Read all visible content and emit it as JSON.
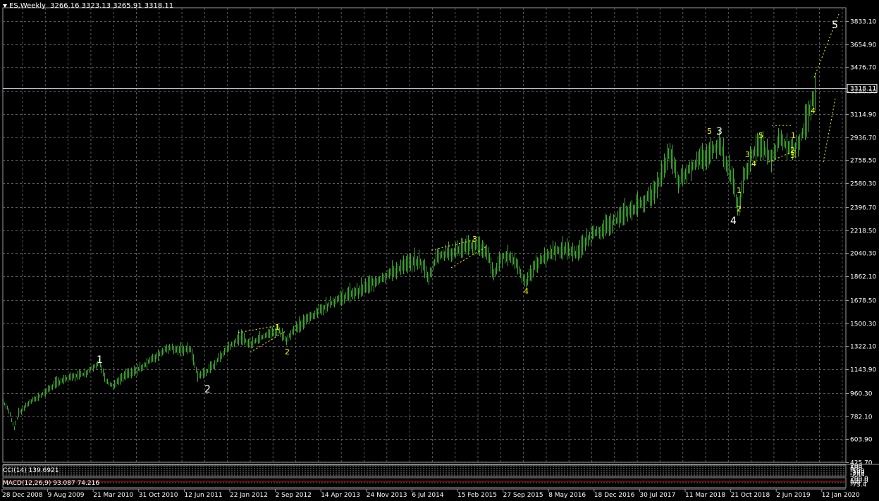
{
  "chart_header": {
    "symbol": "ES,Weekly",
    "ohlc": "3266.16 3323.13 3265.91 3318.11"
  },
  "price_axis": {
    "labels": [
      "3833.10",
      "3654.90",
      "3476.70",
      "3318.11",
      "3296.50",
      "3114.90",
      "2936.70",
      "2758.50",
      "2580.30",
      "2396.70",
      "2218.50",
      "2040.30",
      "1862.10",
      "1678.50",
      "1500.30",
      "1322.10",
      "1143.90",
      "960.30",
      "782.10",
      "603.90",
      "425.70"
    ],
    "current_price": "3318.11",
    "current_price_color": "#ffffff",
    "bid_line_color": "#b8c4d0"
  },
  "time_axis": {
    "labels": [
      "28 Dec 2008",
      "9 Aug 2009",
      "21 Mar 2010",
      "31 Oct 2010",
      "12 Jun 2011",
      "22 Jan 2012",
      "2 Sep 2012",
      "14 Apr 2013",
      "24 Nov 2013",
      "6 Jul 2014",
      "15 Feb 2015",
      "27 Sep 2015",
      "8 May 2016",
      "18 Dec 2016",
      "30 Jul 2017",
      "11 Mar 2018",
      "21 Oct 2018",
      "2 Jun 2019",
      "12 Jan 2020"
    ]
  },
  "indicators": {
    "cci": {
      "label": "CCI(14) 139.6921",
      "axis_values": [
        "200",
        "100",
        "0",
        "-100",
        "-200",
        "-284"
      ]
    },
    "macd": {
      "label": "MACD(12,26,9) 93.087 74.216",
      "axis_values": [
        "200.0",
        "100.0",
        "0.0",
        "-73.4"
      ]
    }
  },
  "wave_labels": [
    {
      "text": "1",
      "color": "#ffffff",
      "size": "large"
    },
    {
      "text": "2",
      "color": "#ffffff",
      "size": "large"
    },
    {
      "text": "1",
      "color": "#ffff00",
      "size": "small"
    },
    {
      "text": "2",
      "color": "#ffff00",
      "size": "small"
    },
    {
      "text": "3",
      "color": "#ffff00",
      "size": "small"
    },
    {
      "text": "4",
      "color": "#ffff00",
      "size": "small"
    },
    {
      "text": "5",
      "color": "#ffff00",
      "size": "small"
    },
    {
      "text": "3",
      "color": "#ffffff",
      "size": "large"
    },
    {
      "text": "4",
      "color": "#ffffff",
      "size": "large"
    },
    {
      "text": "1",
      "color": "#ffff00",
      "size": "small"
    },
    {
      "text": "2",
      "color": "#ffff00",
      "size": "small"
    },
    {
      "text": "3",
      "color": "#ffff00",
      "size": "small"
    },
    {
      "text": "4",
      "color": "#ffff00",
      "size": "small"
    },
    {
      "text": "5",
      "color": "#ffff00",
      "size": "small"
    },
    {
      "text": "1",
      "color": "#ffff00",
      "size": "small"
    },
    {
      "text": "2",
      "color": "#ffff00",
      "size": "small"
    },
    {
      "text": "3",
      "color": "#ffff00",
      "size": "small"
    },
    {
      "text": "4",
      "color": "#ffff00",
      "size": "small"
    },
    {
      "text": "5",
      "color": "#ffffff",
      "size": "large"
    }
  ],
  "colors": {
    "background": "#000000",
    "grid": "#5a5a5a",
    "bars": "#3fa832",
    "wave_primary": "#ffffff",
    "wave_secondary": "#ffff00",
    "cci_line": "#ffffff",
    "macd_line": "#c01818"
  }
}
